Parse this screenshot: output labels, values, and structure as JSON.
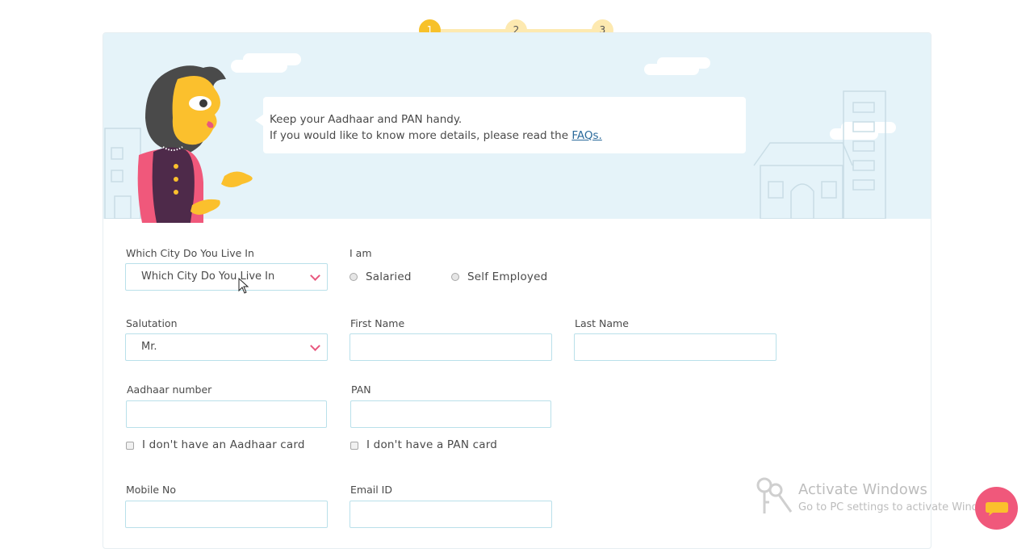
{
  "stepper": {
    "steps": [
      "1",
      "2",
      "3"
    ],
    "active_step": 1
  },
  "banner": {
    "line1": "Keep your Aadhaar and PAN handy.",
    "line2_prefix": "If you would like to know more details, please read the",
    "faq_link": "FAQs."
  },
  "form": {
    "city": {
      "label": "Which City Do You Live In",
      "value": "Which City Do You Live In"
    },
    "employment": {
      "label": "I am",
      "options": [
        "Salaried",
        "Self Employed"
      ]
    },
    "salutation": {
      "label": "Salutation",
      "value": "Mr."
    },
    "first_name": {
      "label": "First Name",
      "value": ""
    },
    "last_name": {
      "label": "Last Name",
      "value": ""
    },
    "aadhaar": {
      "label": "Aadhaar number",
      "value": "",
      "no_card_label": "I don't have an Aadhaar card"
    },
    "pan": {
      "label": "PAN",
      "value": "",
      "no_card_label": "I don't have a PAN card"
    },
    "mobile": {
      "label": "Mobile No",
      "value": ""
    },
    "email": {
      "label": "Email ID",
      "value": ""
    }
  },
  "watermark": {
    "title": "Activate Windows",
    "subtitle": "Go to PC settings to activate Windows."
  },
  "colors": {
    "accent_yellow": "#f7c12a",
    "banner_bg": "#e5f3f9",
    "input_border": "#b9e0ea",
    "chevron_pink": "#e8577e",
    "chat_button": "#f0587b"
  }
}
